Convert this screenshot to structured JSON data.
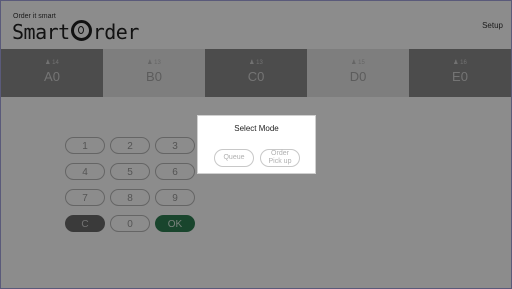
{
  "header": {
    "tagline": "Order it smart",
    "logo_text_pre": "Smart",
    "logo_text_post": "rder",
    "setup_label": "Setup"
  },
  "queues": [
    {
      "count": "♟ 14",
      "code": "A0",
      "style": "dark"
    },
    {
      "count": "♟ 13",
      "code": "B0",
      "style": "light"
    },
    {
      "count": "♟ 13",
      "code": "C0",
      "style": "dark"
    },
    {
      "count": "♟ 15",
      "code": "D0",
      "style": "light"
    },
    {
      "count": "♟ 16",
      "code": "E0",
      "style": "dark"
    }
  ],
  "keypad": {
    "keys": [
      "1",
      "2",
      "3",
      "4",
      "5",
      "6",
      "7",
      "8",
      "9"
    ],
    "clear_label": "C",
    "zero_label": "0",
    "ok_label": "OK"
  },
  "dialog": {
    "title": "Select Mode",
    "queue_label": "Queue",
    "pickup_label": "Order Pick up"
  },
  "colors": {
    "ok_green": "#2f7f52",
    "queue_dark": "#8a8a8a",
    "queue_light": "#e6e6e6"
  }
}
